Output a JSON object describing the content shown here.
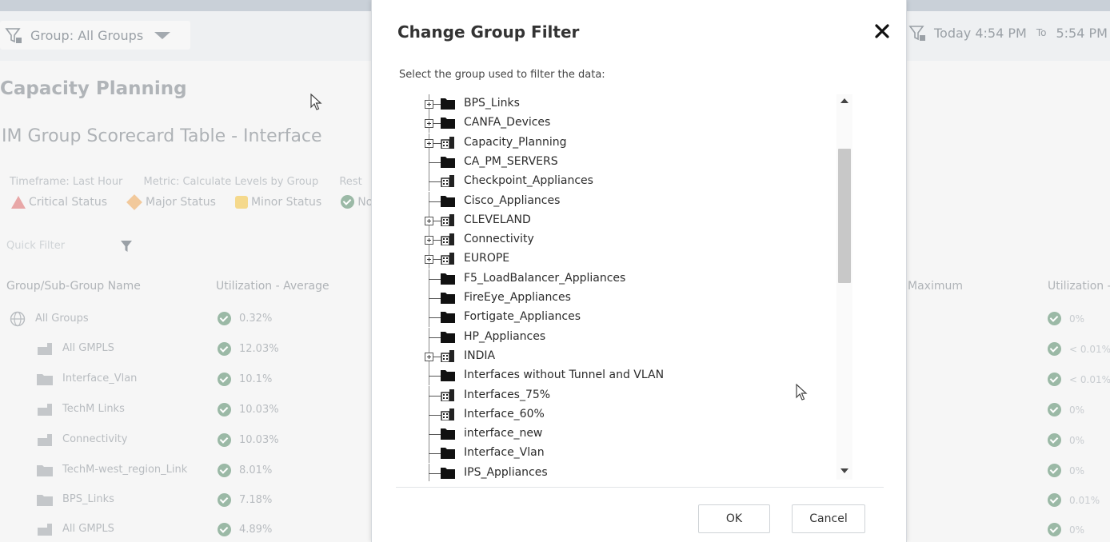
{
  "toolbar": {
    "group_filter_label": "Group: All Groups",
    "time_start": "Today 4:54 PM",
    "time_to": "To",
    "time_end": "5:54 PM"
  },
  "page": {
    "title": "Capacity Planning",
    "subtitle": "IM Group Scorecard Table - Interface",
    "timeframe": "Timeframe: Last Hour",
    "metric": "Metric: Calculate Levels by Group",
    "rest": "Rest",
    "legend": {
      "critical": "Critical Status",
      "major": "Major Status",
      "minor": "Minor Status",
      "normal": "Nor"
    },
    "quick_filter": "Quick Filter",
    "columns": {
      "group_name": "Group/Sub-Group Name",
      "util_avg": "Utilization - Average",
      "maximum": "Maximum",
      "util_right": "Utilization -"
    },
    "rows": [
      {
        "name": "All Groups",
        "value": "0.32%",
        "right": "0%"
      },
      {
        "name": "All GMPLS",
        "value": "12.03%",
        "right": "< 0.01%"
      },
      {
        "name": "Interface_Vlan",
        "value": "10.1%",
        "right": "< 0.01%"
      },
      {
        "name": "TechM Links",
        "value": "10.03%",
        "right": "0%"
      },
      {
        "name": "Connectivity",
        "value": "10.03%",
        "right": "0%"
      },
      {
        "name": "TechM-west_region_Link",
        "value": "8.01%",
        "right": "0%"
      },
      {
        "name": "BPS_Links",
        "value": "7.18%",
        "right": "0.01%"
      },
      {
        "name": "All GMPLS",
        "value": "4.89%",
        "right": "0%"
      }
    ]
  },
  "dialog": {
    "title": "Change Group Filter",
    "prompt": "Select the group used to filter the data:",
    "ok_label": "OK",
    "cancel_label": "Cancel",
    "tree": [
      {
        "label": "BPS_Links",
        "expandable": true,
        "icon": "folder-icon"
      },
      {
        "label": "CANFA_Devices",
        "expandable": true,
        "icon": "folder-icon"
      },
      {
        "label": "Capacity_Planning",
        "expandable": true,
        "icon": "building-icon"
      },
      {
        "label": "CA_PM_SERVERS",
        "expandable": false,
        "icon": "folder-icon"
      },
      {
        "label": "Checkpoint_Appliances",
        "expandable": false,
        "icon": "building-icon"
      },
      {
        "label": "Cisco_Appliances",
        "expandable": false,
        "icon": "folder-icon"
      },
      {
        "label": "CLEVELAND",
        "expandable": true,
        "icon": "building-icon"
      },
      {
        "label": "Connectivity",
        "expandable": true,
        "icon": "building-icon"
      },
      {
        "label": "EUROPE",
        "expandable": true,
        "icon": "building-icon"
      },
      {
        "label": "F5_LoadBalancer_Appliances",
        "expandable": false,
        "icon": "folder-icon"
      },
      {
        "label": "FireEye_Appliances",
        "expandable": false,
        "icon": "folder-icon"
      },
      {
        "label": "Fortigate_Appliances",
        "expandable": false,
        "icon": "folder-icon"
      },
      {
        "label": "HP_Appliances",
        "expandable": false,
        "icon": "folder-icon"
      },
      {
        "label": "INDIA",
        "expandable": true,
        "icon": "building-icon"
      },
      {
        "label": "Interfaces without Tunnel and VLAN",
        "expandable": false,
        "icon": "folder-icon"
      },
      {
        "label": "Interfaces_75%",
        "expandable": false,
        "icon": "building-icon"
      },
      {
        "label": "Interface_60%",
        "expandable": false,
        "icon": "building-icon"
      },
      {
        "label": "interface_new",
        "expandable": false,
        "icon": "folder-icon"
      },
      {
        "label": "Interface_Vlan",
        "expandable": false,
        "icon": "folder-icon"
      },
      {
        "label": "IPS_Appliances",
        "expandable": false,
        "icon": "folder-icon"
      }
    ]
  },
  "colors": {
    "dialog_bg": "#ffffff",
    "critical": "#e8a7a7",
    "major": "#f2c99b",
    "minor": "#f5d98c",
    "normal": "#9bb9a6"
  }
}
